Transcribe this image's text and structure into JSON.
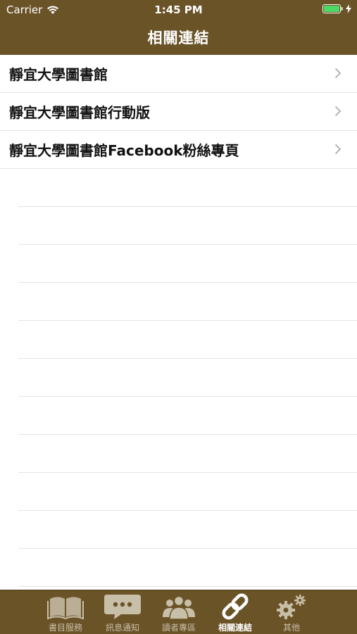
{
  "status_bar": {
    "carrier": "Carrier",
    "time": "1:45 PM"
  },
  "nav": {
    "title": "相關連結"
  },
  "links": [
    {
      "label": "靜宜大學圖書館"
    },
    {
      "label": "靜宜大學圖書館行動版"
    },
    {
      "label": "靜宜大學圖書館Facebook粉絲專頁"
    }
  ],
  "tabs": [
    {
      "label": "書目服務",
      "icon": "book-icon",
      "active": false
    },
    {
      "label": "訊息通知",
      "icon": "chat-bubble-icon",
      "active": false
    },
    {
      "label": "讀者專區",
      "icon": "users-icon",
      "active": false
    },
    {
      "label": "相關連結",
      "icon": "link-icon",
      "active": true
    },
    {
      "label": "其他",
      "icon": "gears-icon",
      "active": false
    }
  ],
  "colors": {
    "bar": "#6b5328",
    "tab_inactive": "#c8bfa8",
    "tab_active": "#ffffff",
    "battery": "#4cd964"
  }
}
